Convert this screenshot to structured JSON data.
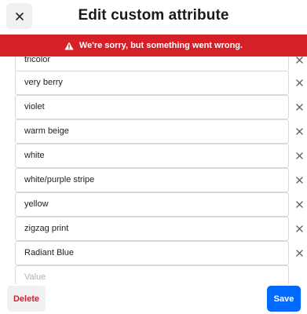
{
  "header": {
    "title": "Edit custom attribute",
    "close_icon": "close-icon"
  },
  "error_banner": {
    "icon": "warning-icon",
    "message": "We're sorry, but something went wrong."
  },
  "values": [
    "tricolor",
    "very berry",
    "violet",
    "warm beige",
    "white",
    "white/purple stripe",
    "yellow",
    "zigzag print",
    "Radiant Blue"
  ],
  "new_value": {
    "placeholder": "Value",
    "value": ""
  },
  "footer": {
    "delete_label": "Delete",
    "save_label": "Save"
  },
  "colors": {
    "error": "#d62027",
    "primary": "#006aff",
    "delete_text": "#d0202b"
  }
}
